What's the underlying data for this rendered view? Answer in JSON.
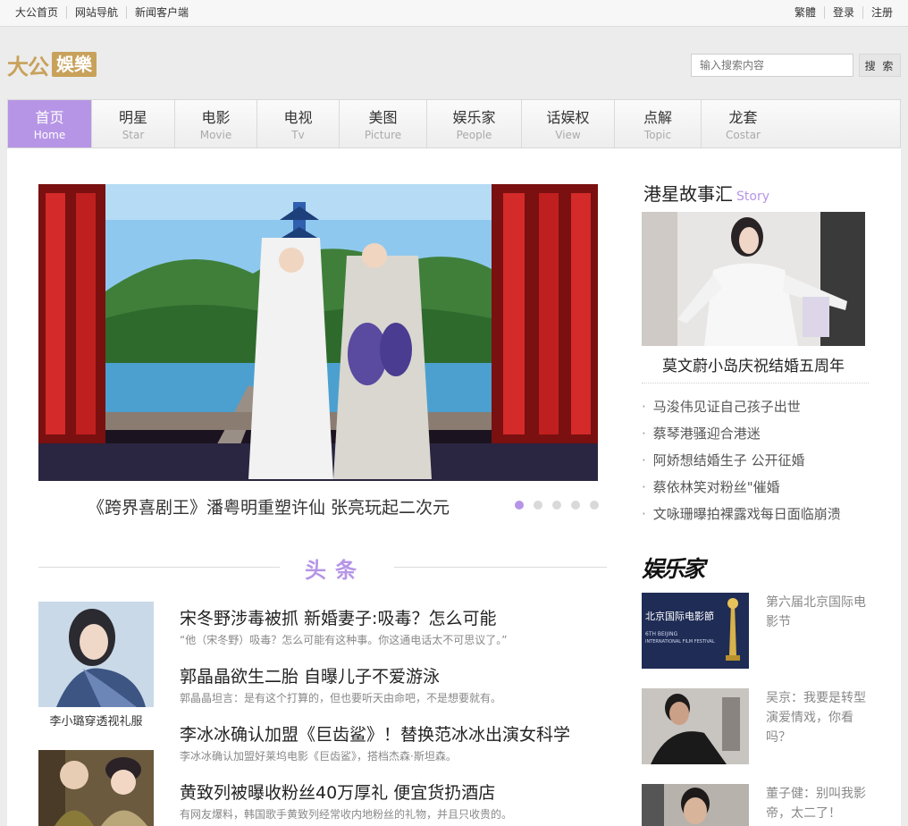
{
  "topbar": {
    "left": [
      "大公首页",
      "网站导航",
      "新闻客户端"
    ],
    "right": [
      "繁體",
      "登录",
      "注册"
    ]
  },
  "logo": {
    "brand": "大公",
    "section": "娛樂"
  },
  "search": {
    "placeholder": "输入搜索内容",
    "button": "搜 索"
  },
  "nav": [
    {
      "cn": "首页",
      "en": "Home"
    },
    {
      "cn": "明星",
      "en": "Star"
    },
    {
      "cn": "电影",
      "en": "Movie"
    },
    {
      "cn": "电视",
      "en": "Tv"
    },
    {
      "cn": "美图",
      "en": "Picture"
    },
    {
      "cn": "娱乐家",
      "en": "People"
    },
    {
      "cn": "话娱权",
      "en": "View"
    },
    {
      "cn": "点解",
      "en": "Topic"
    },
    {
      "cn": "龙套",
      "en": "Costar"
    }
  ],
  "hero": {
    "caption": "《跨界喜剧王》潘粤明重塑许仙 张亮玩起二次元",
    "slides": 5,
    "active_slide": 1
  },
  "headlines": {
    "title": "头条",
    "thumbs": [
      {
        "caption": "李小璐穿透视礼服"
      },
      {
        "caption": ""
      }
    ],
    "items": [
      {
        "title": "宋冬野涉毒被抓 新婚妻子:吸毒？怎么可能",
        "desc": "“他（宋冬野）吸毒？怎么可能有这种事。你这通电话太不可思议了。”"
      },
      {
        "title": "郭晶晶欲生二胎 自曝儿子不爱游泳",
        "desc": "郭晶晶坦言：是有这个打算的，但也要听天由命吧，不是想要就有。"
      },
      {
        "title": "李冰冰确认加盟《巨齿鲨》！替换范冰冰出演女科学",
        "desc": "李冰冰确认加盟好莱坞电影《巨齿鲨》，搭档杰森·斯坦森。"
      },
      {
        "title": "黄致列被曝收粉丝40万厚礼 便宜货扔酒店",
        "desc": "有网友爆料，韩国歌手黄致列经常收内地粉丝的礼物，并且只收贵的。"
      }
    ]
  },
  "story": {
    "title": "港星故事汇",
    "title_en": "Story",
    "feature_caption": "莫文蔚小岛庆祝结婚五周年",
    "list": [
      "马浚伟见证自己孩子出世",
      "蔡琴港骚迎合港迷",
      "阿娇想结婚生子 公开征婚",
      "蔡依林笑对粉丝\"催婚",
      "文咏珊曝拍裸露戏每日面临崩溃"
    ]
  },
  "yulejia": {
    "logo": "娱乐家",
    "poster_text": [
      "北京国际电影節",
      "6TH BEIJING",
      "INTERNATIONAL FILM FESTIVAL"
    ],
    "items": [
      {
        "text": "第六届北京国际电影节"
      },
      {
        "text": "吴京：我要是转型演爱情戏，你看吗？"
      },
      {
        "text": "董子健：别叫我影帝，太二了！"
      }
    ]
  }
}
